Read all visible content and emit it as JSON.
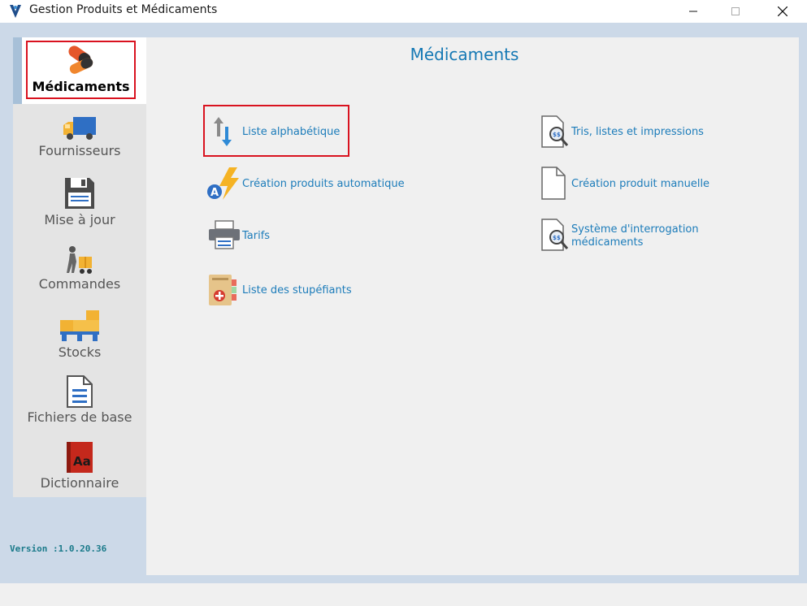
{
  "window": {
    "title": "Gestion Produits et Médicaments"
  },
  "sidebar": {
    "items": [
      {
        "label": "Médicaments",
        "icon": "pills-icon",
        "active": true
      },
      {
        "label": "Fournisseurs",
        "icon": "delivery-truck-icon"
      },
      {
        "label": "Mise à jour",
        "icon": "floppy-disk-icon"
      },
      {
        "label": "Commandes",
        "icon": "delivery-person-icon"
      },
      {
        "label": "Stocks",
        "icon": "pallet-boxes-icon"
      },
      {
        "label": "Fichiers de base",
        "icon": "document-icon"
      },
      {
        "label": "Dictionnaire",
        "icon": "dictionary-book-icon"
      }
    ],
    "version": "Version :1.0.20.36"
  },
  "main": {
    "title": "Médicaments",
    "left_links": [
      {
        "label": "Liste alphabétique",
        "icon": "sort-arrows-icon",
        "selected": true
      },
      {
        "label": "Création produits automatique",
        "icon": "auto-lightning-icon"
      },
      {
        "label": "Tarifs",
        "icon": "printer-icon"
      },
      {
        "label": "Liste des stupéfiants",
        "icon": "narcotics-binder-icon"
      }
    ],
    "right_links": [
      {
        "label": "Tris, listes  et impressions",
        "icon": "document-search-icon"
      },
      {
        "label": "Création produit manuelle",
        "icon": "blank-document-icon"
      },
      {
        "label_line1": "Système d'interrogation",
        "label_line2": "médicaments",
        "icon": "document-search-icon"
      }
    ]
  },
  "colors": {
    "accent": "#1478b4",
    "link": "#1c7cba",
    "selection_border": "#d9121f",
    "version_text": "#1a7a8a"
  }
}
